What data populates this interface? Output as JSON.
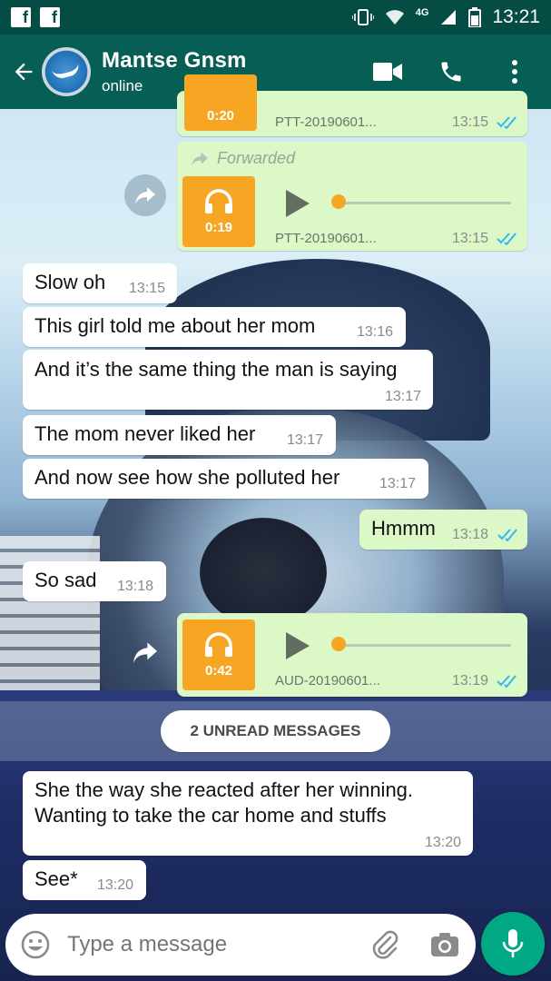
{
  "status_bar": {
    "time": "13:21",
    "network": "4G",
    "icons": [
      "facebook-icon",
      "facebook-icon",
      "vibrate-icon",
      "wifi-icon",
      "signal-icon",
      "battery-icon"
    ]
  },
  "header": {
    "name": "Mantse Gnsm",
    "status": "online"
  },
  "messages": {
    "m0": {
      "duration": "0:20",
      "file": "PTT-20190601...",
      "time": "13:15"
    },
    "m1": {
      "forwarded": "Forwarded",
      "duration": "0:19",
      "file": "PTT-20190601...",
      "time": "13:15"
    },
    "m2": {
      "text": "Slow oh",
      "time": "13:15"
    },
    "m3": {
      "text": "This girl told me about her mom",
      "time": "13:16"
    },
    "m4": {
      "text": "And it’s the same thing the man is saying",
      "time": "13:17"
    },
    "m5": {
      "text": "The mom never liked her",
      "time": "13:17"
    },
    "m6": {
      "text": "And now see how she polluted her",
      "time": "13:17"
    },
    "m7": {
      "text": "Hmmm",
      "time": "13:18"
    },
    "m8": {
      "text": "So sad",
      "time": "13:18"
    },
    "m9": {
      "duration": "0:42",
      "file": "AUD-20190601...",
      "time": "13:19"
    },
    "m10": {
      "line1": "She the way she reacted after her  winning.",
      "line2": "Wanting to take the car home and stuffs",
      "time": "13:20"
    },
    "m11": {
      "text": "See*",
      "time": "13:20"
    }
  },
  "unread_label": "2 UNREAD MESSAGES",
  "input": {
    "placeholder": "Type a message"
  },
  "colors": {
    "app_bar": "#075e54",
    "status_bar": "#054d44",
    "outgoing": "#dcf8c6",
    "incoming": "#ffffff",
    "audio_tile": "#f6a623",
    "tick_blue": "#34b7f1",
    "mic": "#00a884"
  }
}
